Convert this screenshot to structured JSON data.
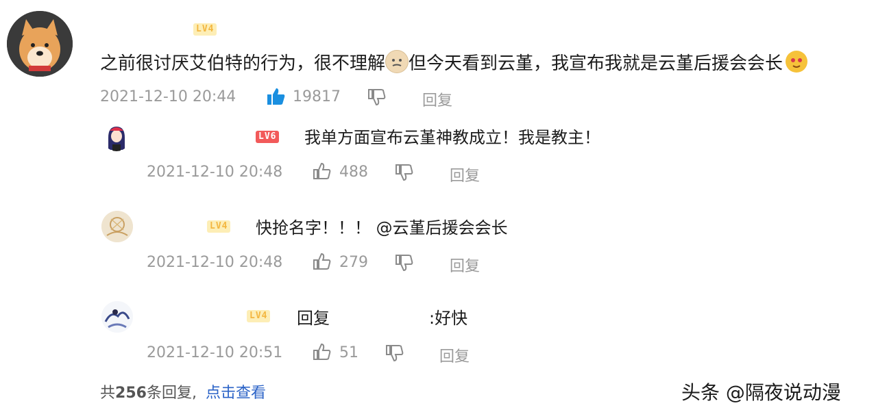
{
  "main_comment": {
    "badge": "LV4",
    "text_parts": [
      "之前很讨厌艾伯特的行为，很不理解",
      "但今天看到云堇，我宣布我就是云堇后援会会长"
    ],
    "emoji_1": "smug-face-emoji",
    "emoji_2": "cat-face-emoji",
    "timestamp": "2021-12-10 20:44",
    "likes": "19817",
    "reply_label": "回复"
  },
  "replies": [
    {
      "badge": "LV6",
      "text": "我单方面宣布云堇神教成立！我是教主！",
      "timestamp": "2021-12-10 20:48",
      "likes": "488",
      "reply_label": "回复"
    },
    {
      "badge": "LV4",
      "text": "快抢名字！！！ @云堇后援会会长",
      "timestamp": "2021-12-10 20:48",
      "likes": "279",
      "reply_label": "回复"
    },
    {
      "badge": "LV4",
      "text_prefix": "回复",
      "text_suffix": ":好快",
      "timestamp": "2021-12-10 20:51",
      "likes": "51",
      "reply_label": "回复"
    }
  ],
  "footer": {
    "prefix": "共",
    "count": "256",
    "suffix": "条回复,",
    "view_link": "点击查看"
  },
  "watermark": "头条 @隔夜说动漫",
  "colors": {
    "accent_like": "#1a8fe0",
    "link": "#2b63c7",
    "meta": "#9a9a9a"
  }
}
